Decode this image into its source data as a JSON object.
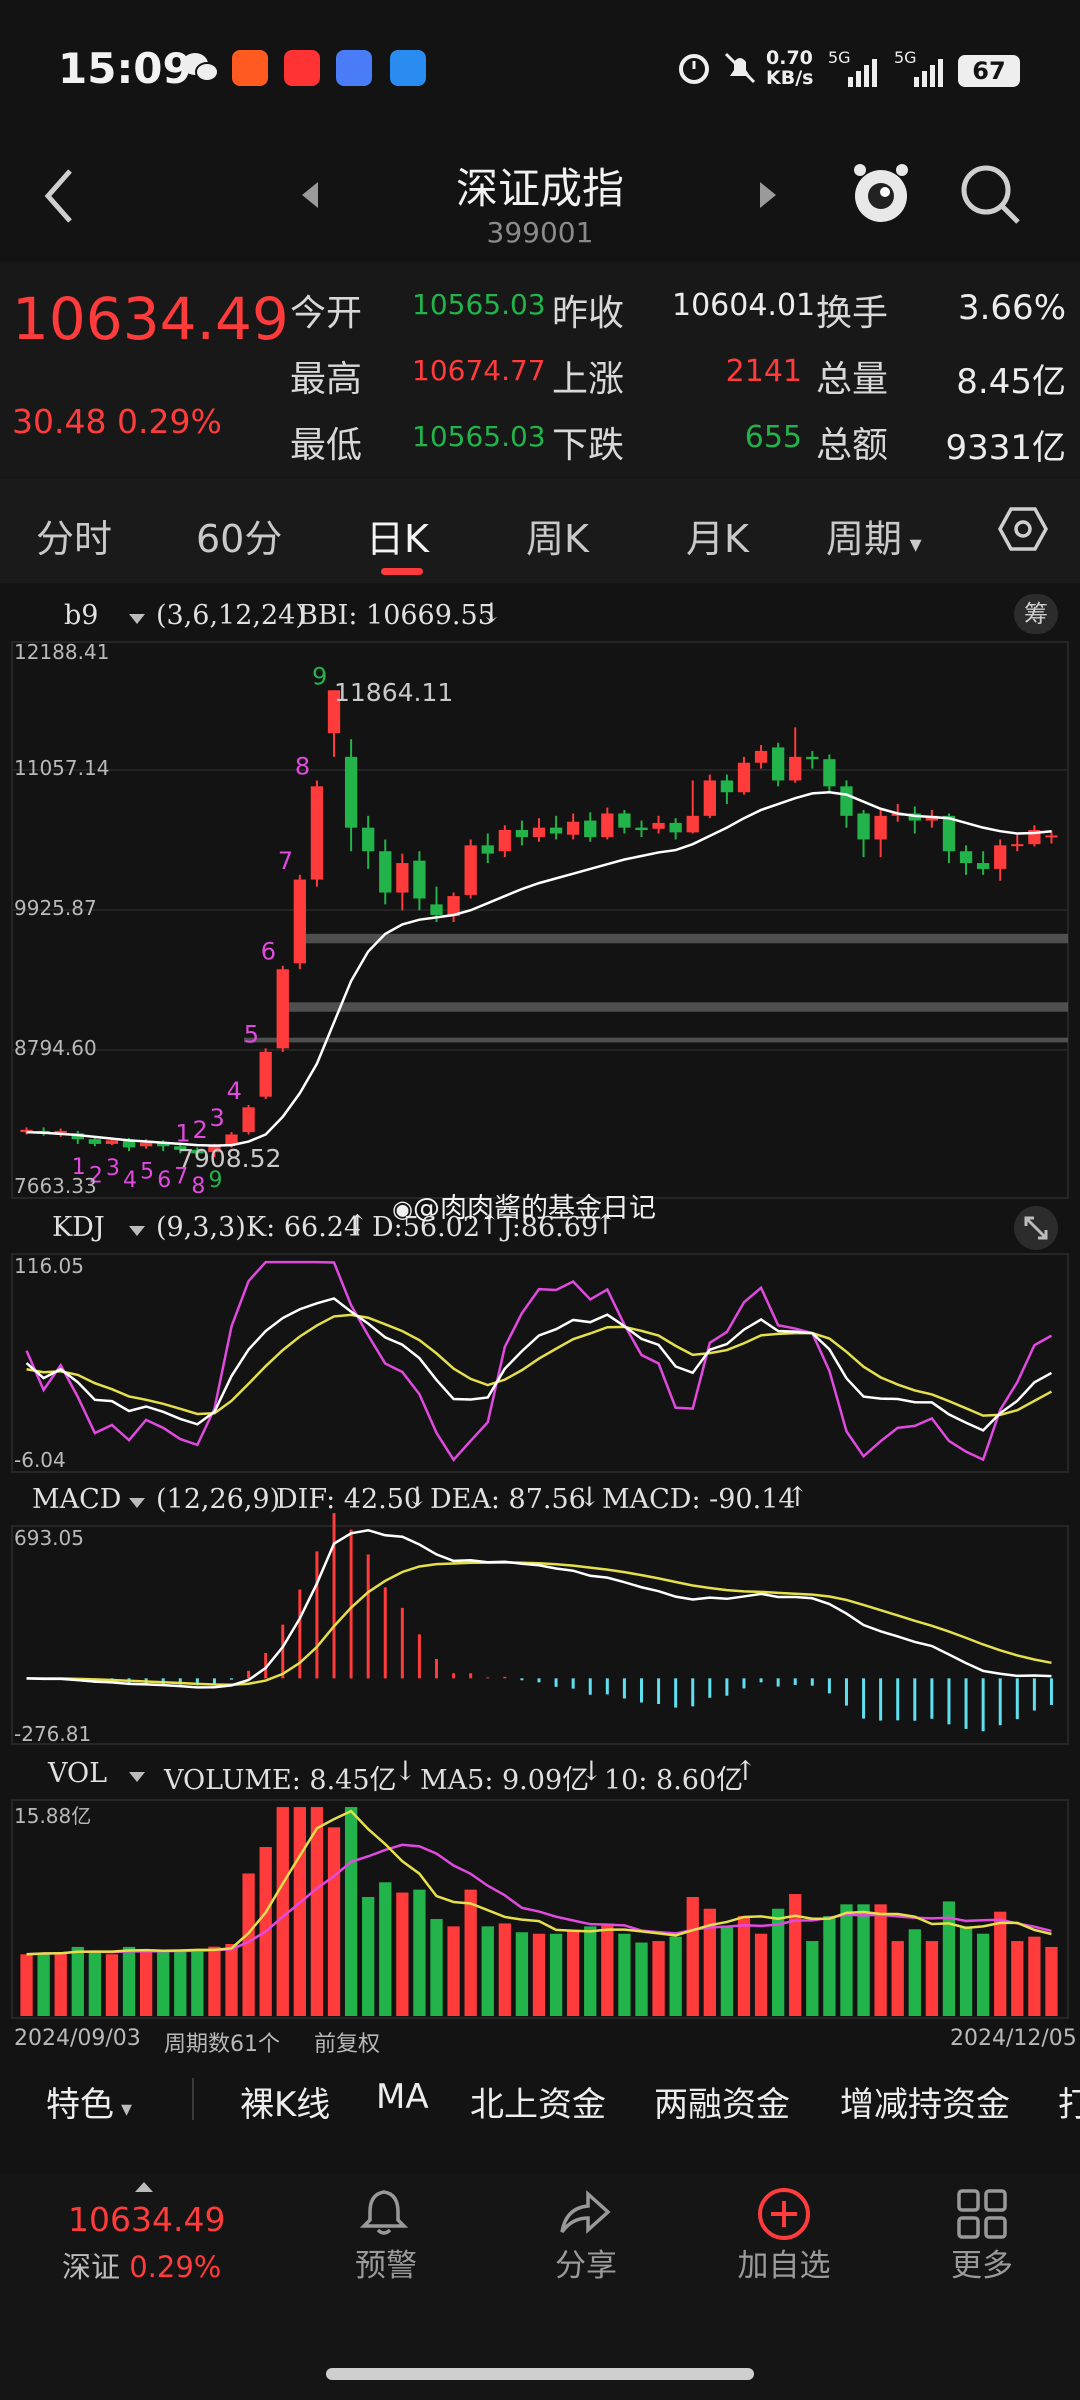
{
  "status_bar": {
    "time": "15:09",
    "net_speed_value": "0.70",
    "net_speed_unit": "KB/s",
    "sim1": "5G",
    "sim2": "5G",
    "battery": "67"
  },
  "nav": {
    "title": "深证成指",
    "code": "399001"
  },
  "quote": {
    "price": "10634.49",
    "change": "30.48 0.29%",
    "rows": [
      {
        "l1": "今开",
        "v1": "10565.03",
        "c1": "green",
        "l2": "昨收",
        "v2": "10604.01",
        "c2": "white",
        "l3": "换手",
        "v3": "3.66%",
        "c3": "white"
      },
      {
        "l1": "最高",
        "v1": "10674.77",
        "c1": "red",
        "l2": "上涨",
        "v2": "2141",
        "c2": "red",
        "l3": "总量",
        "v3": "8.45亿",
        "c3": "white"
      },
      {
        "l1": "最低",
        "v1": "10565.03",
        "c1": "green",
        "l2": "下跌",
        "v2": "655",
        "c2": "green",
        "l3": "总额",
        "v3": "9331亿",
        "c3": "white"
      }
    ]
  },
  "tabs": [
    "分时",
    "60分",
    "日K",
    "周K",
    "月K",
    "周期"
  ],
  "active_tab": "日K",
  "main_chart": {
    "indicator_name": "b9",
    "params": "(3,6,12,24)",
    "bbi_label": "BBI: 10669.55",
    "chip_label": "筹",
    "y_ticks": [
      "12188.41",
      "11057.14",
      "9925.87",
      "8794.60",
      "7663.33"
    ],
    "high_label": "11864.11",
    "low_label": "7908.52",
    "nine_turn_marks": [
      "1",
      "2",
      "3",
      "4",
      "5",
      "6",
      "7",
      "8",
      "9"
    ]
  },
  "kdj": {
    "name": "KDJ",
    "params": "(9,3,3)",
    "k": "K: 66.24",
    "d": "D:56.02",
    "j": "J:86.69",
    "max": "116.05",
    "min": "-6.04"
  },
  "macd": {
    "name": "MACD",
    "params": "(12,26,9)",
    "dif": "DIF: 42.50",
    "dea": "DEA: 87.56",
    "macd": "MACD: -90.14",
    "max": "693.05",
    "min": "-276.81"
  },
  "vol": {
    "name": "VOL",
    "volume": "VOLUME: 8.45亿",
    "ma5": "MA5: 9.09亿",
    "ma10": "10: 8.60亿",
    "max": "15.88亿"
  },
  "footer_info": {
    "start_date": "2024/09/03",
    "period_count": "周期数61个",
    "adjust": "前复权",
    "end_date": "2024/12/05"
  },
  "watermark": "@肉肉酱的基金日记",
  "feature_bar": [
    "特色",
    "裸K线",
    "MA",
    "北上资金",
    "两融资金",
    "增减持资金",
    "打"
  ],
  "bottom_bar": {
    "price": "10634.49",
    "index": "深证",
    "pct": "0.29%",
    "alert": "预警",
    "share": "分享",
    "add": "加自选",
    "more": "更多"
  },
  "colors": {
    "up": "#ff3b3b",
    "down": "#22b34a",
    "bbi": "#ffffff",
    "yellow": "#e4df4a",
    "magenta": "#e04adf",
    "cyan": "#5fe0f0"
  },
  "chart_data": {
    "type": "candlestick",
    "title": "深证成指 日K",
    "x_start": "2024/09/03",
    "x_end": "2024/12/05",
    "ylim": [
      7663.33,
      12188.41
    ],
    "candles": [
      [
        8120,
        8140,
        8100,
        8160
      ],
      [
        8130,
        8110,
        8090,
        8160
      ],
      [
        8110,
        8130,
        8080,
        8150
      ],
      [
        8110,
        8060,
        8020,
        8130
      ],
      [
        8060,
        8020,
        8000,
        8080
      ],
      [
        8020,
        8050,
        8010,
        8070
      ],
      [
        8050,
        7990,
        7960,
        8070
      ],
      [
        8000,
        8030,
        7980,
        8060
      ],
      [
        8030,
        8000,
        7960,
        8050
      ],
      [
        8000,
        7970,
        7940,
        8030
      ],
      [
        7970,
        7940,
        7910,
        7990
      ],
      [
        7950,
        8000,
        7908,
        8020
      ],
      [
        8010,
        8100,
        7990,
        8120
      ],
      [
        8120,
        8330,
        8100,
        8350
      ],
      [
        8420,
        8800,
        8400,
        8830
      ],
      [
        8830,
        9500,
        8800,
        9530
      ],
      [
        9550,
        10260,
        9500,
        10300
      ],
      [
        10260,
        11050,
        10200,
        11100
      ],
      [
        11500,
        11864,
        11300,
        11864
      ],
      [
        11300,
        10700,
        10500,
        11450
      ],
      [
        10700,
        10500,
        10350,
        10800
      ],
      [
        10500,
        10150,
        10050,
        10600
      ],
      [
        10150,
        10400,
        10000,
        10480
      ],
      [
        10420,
        10100,
        10000,
        10500
      ],
      [
        10050,
        9960,
        9900,
        10200
      ],
      [
        9950,
        10120,
        9900,
        10150
      ],
      [
        10130,
        10550,
        10100,
        10600
      ],
      [
        10550,
        10480,
        10400,
        10650
      ],
      [
        10500,
        10680,
        10450,
        10720
      ],
      [
        10680,
        10620,
        10550,
        10760
      ],
      [
        10620,
        10700,
        10580,
        10780
      ],
      [
        10700,
        10650,
        10600,
        10800
      ],
      [
        10640,
        10750,
        10600,
        10820
      ],
      [
        10760,
        10620,
        10580,
        10830
      ],
      [
        10620,
        10820,
        10600,
        10870
      ],
      [
        10820,
        10700,
        10650,
        10850
      ],
      [
        10700,
        10680,
        10620,
        10760
      ],
      [
        10690,
        10740,
        10650,
        10800
      ],
      [
        10740,
        10660,
        10600,
        10780
      ],
      [
        10660,
        10800,
        10650,
        11100
      ],
      [
        10800,
        11100,
        10780,
        11150
      ],
      [
        11100,
        11000,
        10900,
        11150
      ],
      [
        11000,
        11250,
        10980,
        11300
      ],
      [
        11250,
        11350,
        11200,
        11400
      ],
      [
        11380,
        11100,
        11050,
        11420
      ],
      [
        11100,
        11300,
        11080,
        11550
      ],
      [
        11300,
        11280,
        11200,
        11350
      ],
      [
        11280,
        11050,
        11000,
        11320
      ],
      [
        11050,
        10800,
        10700,
        11100
      ],
      [
        10820,
        10600,
        10450,
        10850
      ],
      [
        10600,
        10800,
        10450,
        10850
      ],
      [
        10800,
        10820,
        10750,
        10900
      ],
      [
        10820,
        10760,
        10650,
        10880
      ],
      [
        10760,
        10800,
        10700,
        10850
      ],
      [
        10800,
        10500,
        10400,
        10820
      ],
      [
        10500,
        10400,
        10300,
        10550
      ],
      [
        10400,
        10350,
        10300,
        10500
      ],
      [
        10350,
        10550,
        10250,
        10600
      ],
      [
        10550,
        10560,
        10500,
        10650
      ],
      [
        10560,
        10680,
        10540,
        10720
      ],
      [
        10620,
        10634,
        10565,
        10675
      ]
    ],
    "bbi": [
      8120,
      8115,
      8105,
      8095,
      8080,
      8065,
      8050,
      8040,
      8030,
      8020,
      8010,
      8005,
      8010,
      8040,
      8100,
      8250,
      8450,
      8700,
      9050,
      9400,
      9650,
      9800,
      9880,
      9920,
      9940,
      9960,
      10000,
      10060,
      10120,
      10180,
      10230,
      10270,
      10310,
      10350,
      10390,
      10430,
      10460,
      10490,
      10510,
      10560,
      10630,
      10700,
      10780,
      10850,
      10900,
      10950,
      10990,
      11000,
      10980,
      10920,
      10860,
      10820,
      10800,
      10790,
      10780,
      10740,
      10700,
      10670,
      10650,
      10655,
      10669.55
    ]
  }
}
